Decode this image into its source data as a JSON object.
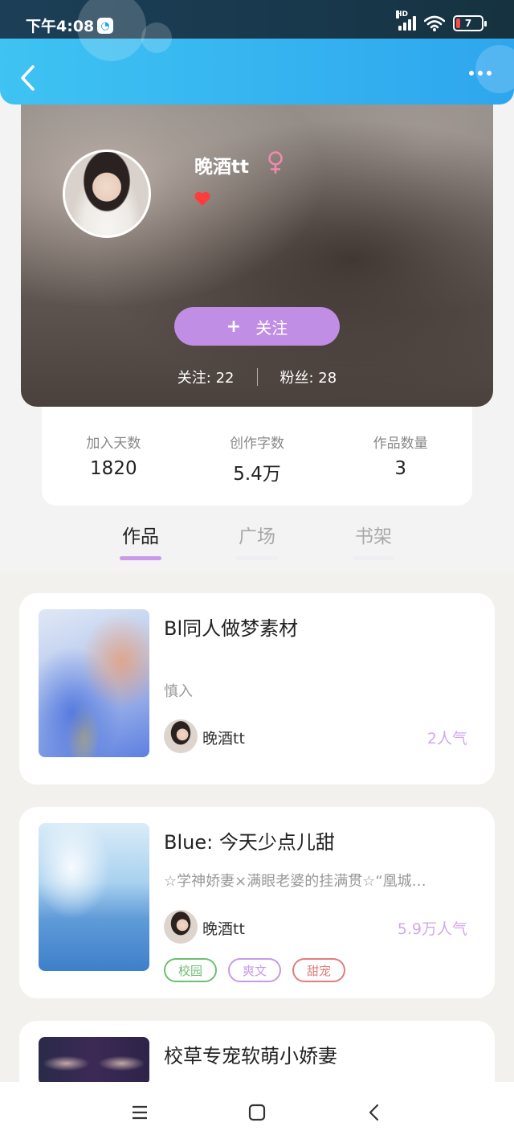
{
  "status_bar": {
    "time": "下午4:08",
    "battery_level": "7",
    "icons": [
      "app-badge-icon",
      "signal-icon",
      "wifi-icon",
      "battery-icon"
    ]
  },
  "header": {
    "back_icon": "chevron-left-icon",
    "more_icon": "more-dots-icon"
  },
  "profile": {
    "name": "晚酒tt",
    "gender_icon": "female-icon",
    "badge_icon": "heart-icon",
    "follow_plus": "+",
    "follow_label": "关注",
    "following_label": "关注: 22",
    "followers_label": "粉丝: 28"
  },
  "stats": [
    {
      "label": "加入天数",
      "value": "1820"
    },
    {
      "label": "创作字数",
      "value": "5.4万"
    },
    {
      "label": "作品数量",
      "value": "3"
    }
  ],
  "tabs": [
    {
      "label": "作品",
      "active": true
    },
    {
      "label": "广场",
      "active": false
    },
    {
      "label": "书架",
      "active": false
    }
  ],
  "works": [
    {
      "title": "Bl同人做梦素材",
      "description": "慎入",
      "author": "晚酒tt",
      "popularity": "2人气",
      "tags": []
    },
    {
      "title": "Blue: 今天少点儿甜",
      "description": "☆学神娇妻×满眼老婆的挂满贯☆“凰城…",
      "author": "晚酒tt",
      "popularity": "5.9万人气",
      "tags": [
        {
          "label": "校园",
          "color": "#6cbf70"
        },
        {
          "label": "爽文",
          "color": "#c79ae6"
        },
        {
          "label": "甜宠",
          "color": "#e07c7c"
        }
      ]
    },
    {
      "title": "校草专宠软萌小娇妻",
      "description": "",
      "author": "",
      "popularity": "",
      "tags": []
    }
  ],
  "nav": {
    "icons": [
      "menu-icon",
      "home-square-icon",
      "back-triangle-icon"
    ]
  },
  "colors": {
    "header_blue": "#2ea6ee",
    "accent_purple": "#c08ee4",
    "popularity_purple": "#d2a8ec"
  }
}
